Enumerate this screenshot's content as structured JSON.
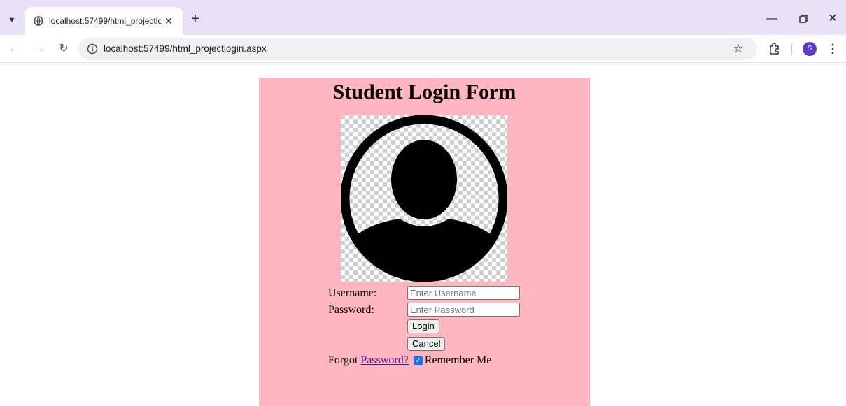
{
  "browser": {
    "tab_title": "localhost:57499/html_projectlo",
    "url": "localhost:57499/html_projectlogin.aspx",
    "profile_initial": "S",
    "accent_color": "#5f3ac9"
  },
  "page": {
    "title": "Student Login Form",
    "background_color": "#ffb6c1",
    "username_label": "Username:",
    "username_placeholder": "Enter Username",
    "password_label": "Password:",
    "password_placeholder": "Enter Password",
    "login_label": "Login",
    "cancel_label": "Cancel",
    "forgot_text": "Forgot",
    "forgot_link": "Password?",
    "remember_label": "Remember Me",
    "remember_checked": true,
    "avatar_icon": "user-silhouette-icon"
  }
}
